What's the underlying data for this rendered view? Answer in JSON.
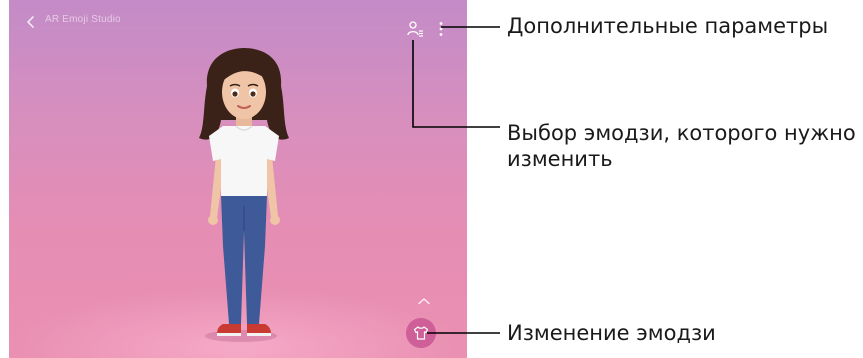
{
  "app": {
    "title": "AR Emoji Studio"
  },
  "icons": {
    "back": "chevron-left-icon",
    "select_emoji": "person-list-icon",
    "more": "vertical-dots-icon",
    "expand": "chevron-up-icon",
    "edit": "tshirt-icon"
  },
  "colors": {
    "background_top": "#c38bc8",
    "background_bottom": "#ea90b2",
    "edit_button": "#ce5f98",
    "callout_line": "#000000"
  },
  "callouts": [
    {
      "text": "Дополнительные параметры"
    },
    {
      "text_line1": "Выбор эмодзи, которого нужно",
      "text_line2": "изменить"
    },
    {
      "text": "Изменение эмодзи"
    }
  ]
}
